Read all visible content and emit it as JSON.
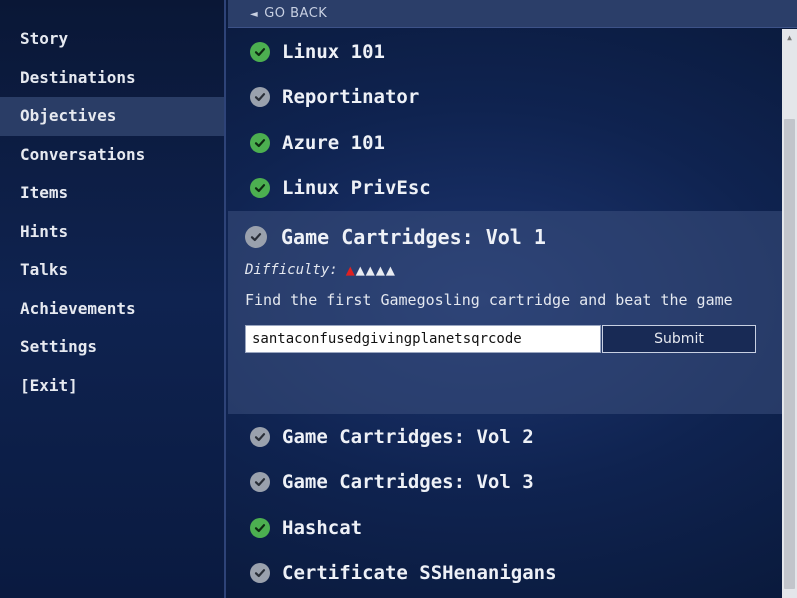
{
  "sidebar": {
    "items": [
      {
        "label": "Story"
      },
      {
        "label": "Destinations"
      },
      {
        "label": "Objectives",
        "active": true
      },
      {
        "label": "Conversations"
      },
      {
        "label": "Items"
      },
      {
        "label": "Hints"
      },
      {
        "label": "Talks"
      },
      {
        "label": "Achievements"
      },
      {
        "label": "Settings"
      },
      {
        "label": "[Exit]"
      }
    ]
  },
  "main": {
    "go_back": "GO BACK",
    "objectives_before": [
      {
        "title": "Linux 101",
        "status": "complete"
      },
      {
        "title": "Reportinator",
        "status": "incomplete"
      },
      {
        "title": "Azure 101",
        "status": "complete"
      },
      {
        "title": "Linux PrivEsc",
        "status": "complete"
      }
    ],
    "expanded": {
      "title": "Game Cartridges: Vol 1",
      "status": "incomplete",
      "difficulty_label": "Difficulty:",
      "difficulty": 1,
      "difficulty_max": 5,
      "description": "Find the first Gamegosling cartridge and beat the game",
      "answer_value": "santaconfusedgivingplanetsqrcode",
      "submit_label": "Submit"
    },
    "objectives_after": [
      {
        "title": "Game Cartridges: Vol 2",
        "status": "incomplete"
      },
      {
        "title": "Game Cartridges: Vol 3",
        "status": "incomplete"
      },
      {
        "title": "Hashcat",
        "status": "complete"
      },
      {
        "title": "Certificate SSHenanigans",
        "status": "incomplete"
      }
    ]
  },
  "colors": {
    "complete": "#4caf50",
    "incomplete": "#9aa1ad",
    "difficulty_on": "#e02020",
    "difficulty_off": "#e8ebf1"
  }
}
